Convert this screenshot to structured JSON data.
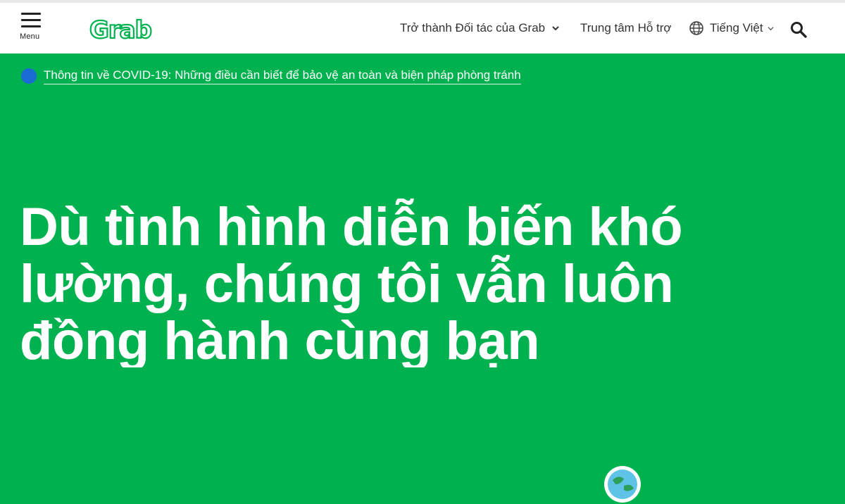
{
  "header": {
    "menu_label": "Menu",
    "logo_text": "Grab",
    "nav": {
      "partner_label": "Trở thành Đối tác của Grab",
      "support_label": "Trung tâm Hỗ trợ",
      "language_label": "Tiếng Việt"
    },
    "icons": {
      "menu": "hamburger-icon",
      "partner_dropdown": "chevron-down-icon",
      "language": "globe-icon",
      "language_dropdown": "chevron-down-icon",
      "search": "search-icon"
    }
  },
  "banner": {
    "covid_link": "Thông tin về COVID-19: Những điều cần biết để bảo vệ an toàn và biện pháp phòng tránh"
  },
  "hero": {
    "title": "Dù tình hình diễn biến khó lường, chúng tôi vẫn luôn đồng hành cùng bạn"
  },
  "colors": {
    "brand_green": "#00b14f",
    "logo_green": "#00b14f",
    "banner_dot": "#1a6bd4",
    "text_dark": "#333333",
    "white": "#ffffff"
  }
}
